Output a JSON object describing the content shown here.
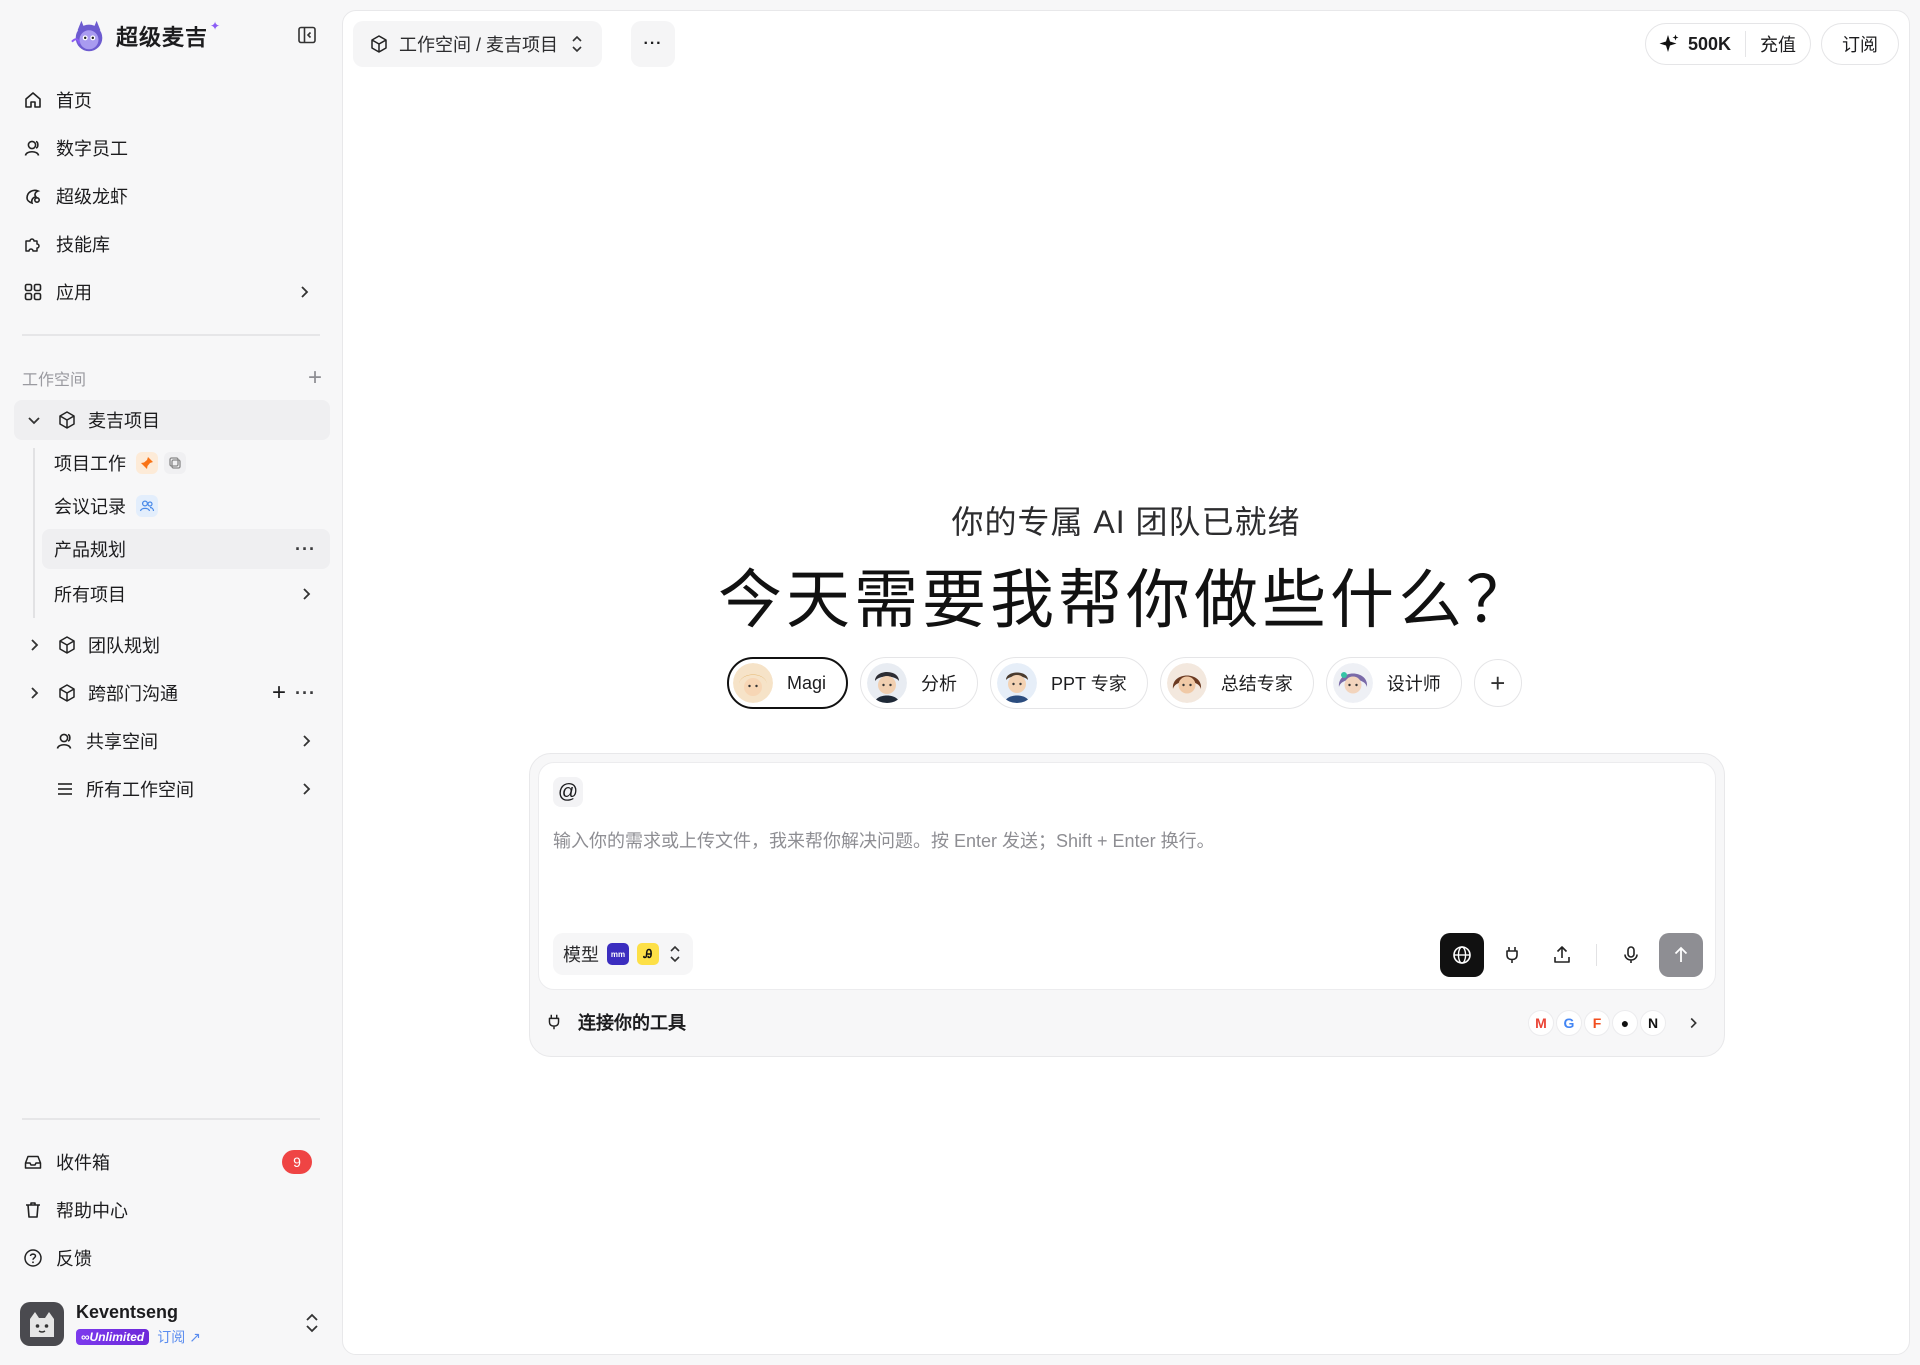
{
  "brand": {
    "name": "超级麦吉",
    "star": "✦"
  },
  "nav": [
    {
      "label": "首页",
      "icon": "home-icon"
    },
    {
      "label": "数字员工",
      "icon": "user-icon"
    },
    {
      "label": "超级龙虾",
      "icon": "lobster-icon"
    },
    {
      "label": "技能库",
      "icon": "puzzle-icon"
    },
    {
      "label": "应用",
      "icon": "apps-grid-icon"
    }
  ],
  "workspace": {
    "header": "工作空间",
    "projects": [
      {
        "label": "麦吉项目",
        "expanded": true
      },
      {
        "label": "团队规划",
        "expanded": false
      },
      {
        "label": "跨部门沟通",
        "expanded": false
      }
    ],
    "subitems": [
      {
        "label": "项目工作"
      },
      {
        "label": "会议记录"
      },
      {
        "label": "产品规划"
      },
      {
        "label": "所有项目"
      }
    ],
    "shared": "共享空间",
    "all_workspaces": "所有工作空间"
  },
  "bottom_nav": {
    "inbox": "收件箱",
    "inbox_count": "9",
    "help": "帮助中心",
    "feedback": "反馈"
  },
  "user": {
    "name": "Keventseng",
    "plan": "∞Unlimited",
    "subscribe_link": "订阅 ↗"
  },
  "topbar": {
    "breadcrumb": "工作空间 / 麦吉项目",
    "more": "···",
    "credits": "500K",
    "topup": "充值",
    "subscribe": "订阅"
  },
  "hero": {
    "subtitle": "你的专属 AI 团队已就绪",
    "title": "今天需要我帮你做些什么？"
  },
  "agents": [
    {
      "label": "Magi",
      "active": true
    },
    {
      "label": "分析",
      "active": false
    },
    {
      "label": "PPT 专家",
      "active": false
    },
    {
      "label": "总结专家",
      "active": false
    },
    {
      "label": "设计师",
      "active": false
    }
  ],
  "composer": {
    "at": "@",
    "placeholder": "输入你的需求或上传文件，我来帮你解决问题。按 Enter 发送；Shift + Enter 换行。",
    "model_label": "模型",
    "connect_label": "连接你的工具"
  },
  "colors": {
    "accent": "#8b5cf6",
    "badge": "#ef4444",
    "send": "#8e8e93"
  }
}
